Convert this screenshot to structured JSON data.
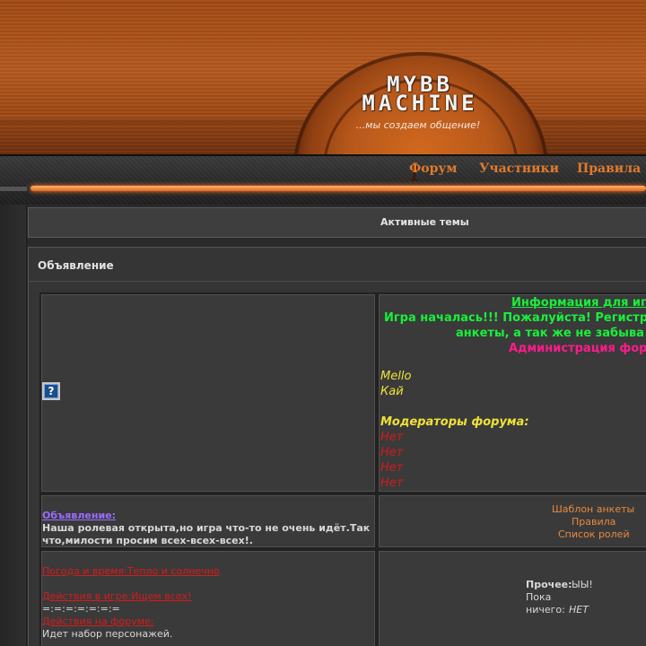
{
  "header": {
    "logo_line1": "MYBB",
    "logo_line2": "MACHINE",
    "tagline": "...мы создаем общение!"
  },
  "nav": {
    "items": [
      "Форум",
      "Участники",
      "Правила"
    ]
  },
  "active_topics": {
    "label": "Активные темы"
  },
  "announcement": {
    "title": "Объявление",
    "info_heading": "Информация для иг",
    "info_line1": "Игра началась!!! Пожалуйста! Регистр",
    "info_line2": "анкеты, а так же не забыва",
    "info_line3": "Администрация фор",
    "admins": [
      "Mello",
      "Кай"
    ],
    "moderators_label": "Модераторы форума:",
    "moderators": [
      "Нет",
      "Нет",
      "Нет",
      "Нет"
    ],
    "notice_label": "Объявление:",
    "notice_text_line1": "Наша ролевая открыта,но игра что-то не очень идёт.Так",
    "notice_text_line2": "что,милости просим всех-всех-всех!.",
    "links": [
      "Шаблон анкеты",
      "Правила",
      "Список ролей"
    ],
    "weather_link": "Погода и время:Тепло и солнечно",
    "game_actions_link": "Действия в игре:Ищем всех!",
    "separator": "=:=:=:=:=:=:=",
    "forum_actions_link": "Действия на форуме:",
    "forum_actions_text": "Идет набор персонажей.",
    "other_label": "Прочее:",
    "other_value": "ЫЫ!",
    "other_line2": "Пока",
    "other_line3_prefix": "ничего:",
    "other_line3_value": "НЕТ"
  },
  "colors": {
    "accent_orange": "#e07a2e",
    "green": "#19f03a",
    "pink": "#ff1a8c",
    "yellow": "#f0e23a",
    "red": "#d61a1a"
  }
}
